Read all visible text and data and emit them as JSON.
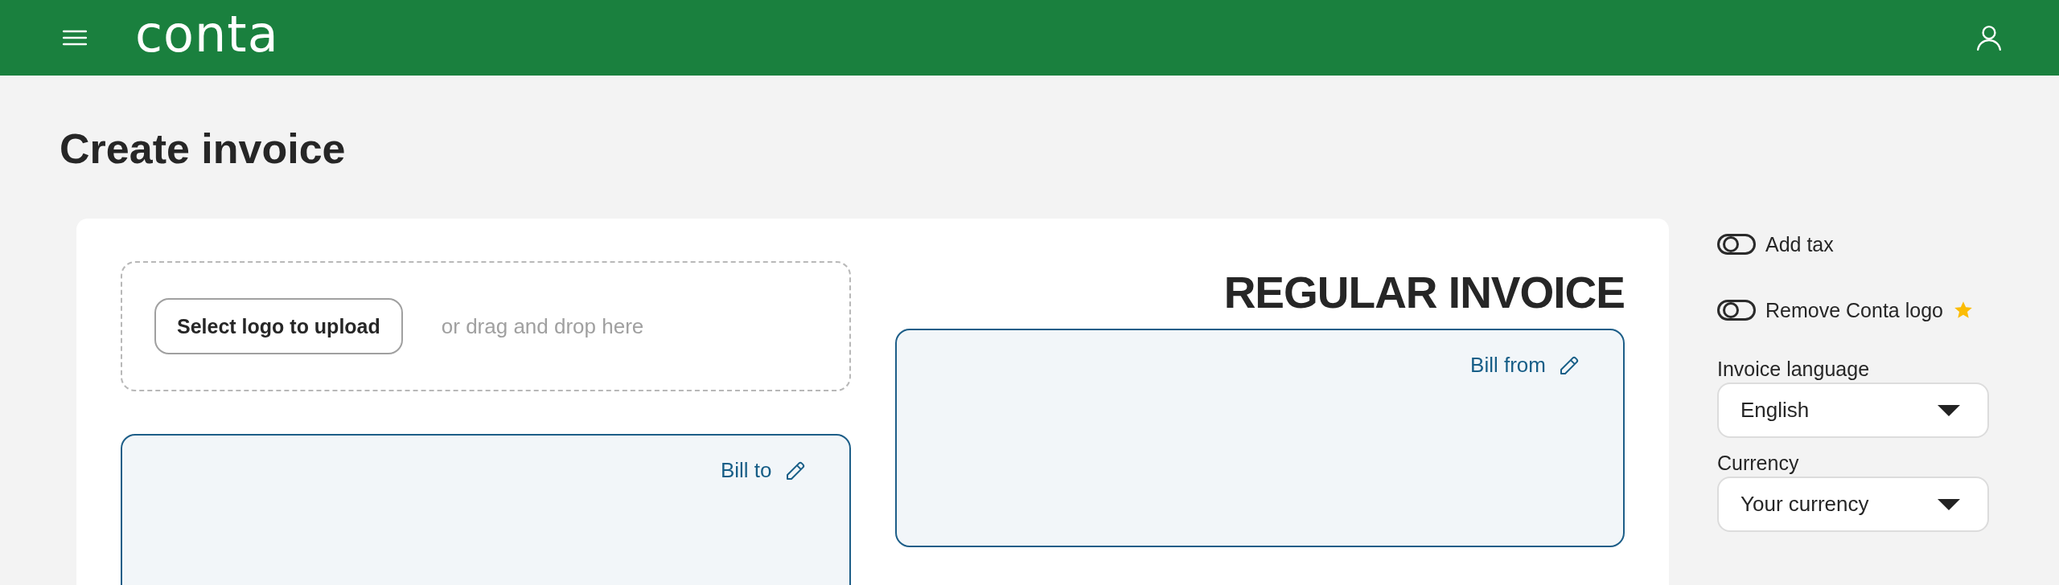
{
  "header": {
    "logo": "conta"
  },
  "page": {
    "title": "Create invoice"
  },
  "invoice": {
    "logo_upload": {
      "button": "Select logo to upload",
      "hint": "or drag and drop here"
    },
    "type_title": "REGULAR INVOICE",
    "bill_from": {
      "label": "Bill from"
    },
    "bill_to": {
      "label": "Bill to"
    }
  },
  "settings": {
    "toggles": [
      {
        "label": "Add tax",
        "on": false,
        "premium": false
      },
      {
        "label": "Remove Conta logo",
        "on": false,
        "premium": true
      }
    ],
    "selects": [
      {
        "label": "Invoice language",
        "value": "English"
      },
      {
        "label": "Currency",
        "value": "Your currency"
      }
    ]
  }
}
